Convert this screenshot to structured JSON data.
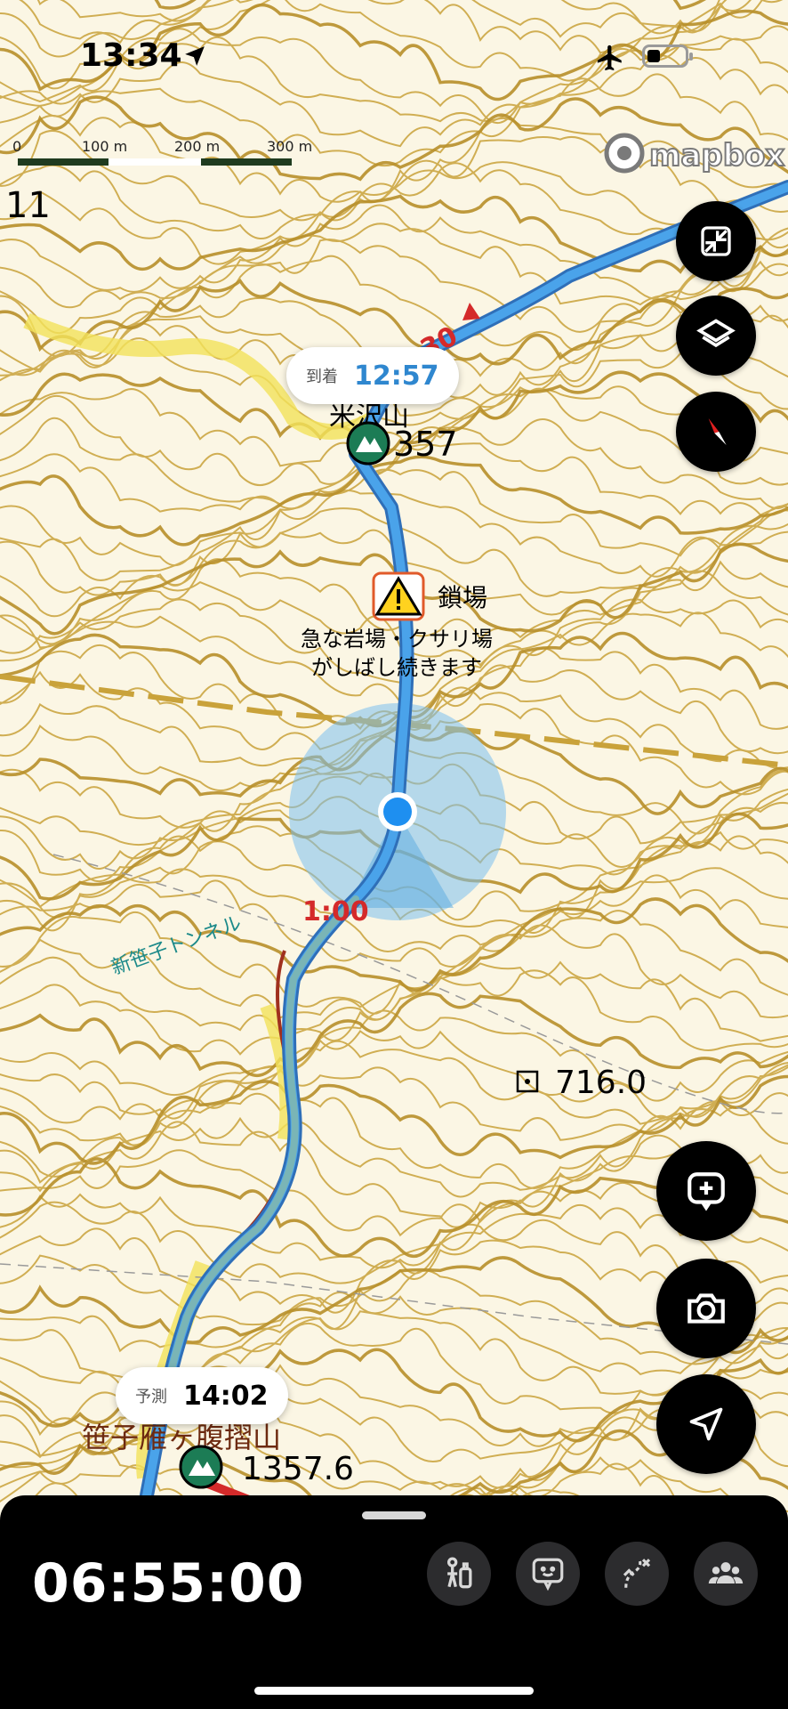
{
  "status_bar": {
    "time": "13:34"
  },
  "scale_bar": {
    "labels": [
      "0",
      "100 m",
      "200 m",
      "300 m"
    ]
  },
  "attribution": {
    "text": "mapbox"
  },
  "map_labels": {
    "edge_number": "11",
    "route_time_top": "30",
    "peak_top_name": "米沢山",
    "peak_top_elev": "357",
    "hazard_title": "鎖場",
    "hazard_line1": "急な岩場・クサリ場",
    "hazard_line2": "がしばし続きます",
    "route_time_mid": "1:00",
    "tunnel": "新笹子トンネル",
    "benchmark_elev": "716.0",
    "peak_bottom_name": "笹子雁ヶ腹摺山",
    "peak_bottom_elev": "1357.6"
  },
  "arrival_bubble": {
    "label": "到着",
    "time": "12:57"
  },
  "forecast_bubble": {
    "label": "予測",
    "time": "14:02"
  },
  "buttons": {
    "fullscreen": "fullscreen-exit-icon",
    "layers": "layers-icon",
    "compass": "compass-icon",
    "add_note": "add-memo-icon",
    "camera": "camera-icon",
    "locate": "location-arrow-icon"
  },
  "bottom_panel": {
    "elapsed": "06:55:00"
  },
  "colors": {
    "route_blue": "#3f97e0",
    "route_red": "#d42a2a",
    "contour": "#c9a23a",
    "accent_text": "#2f87cf"
  }
}
